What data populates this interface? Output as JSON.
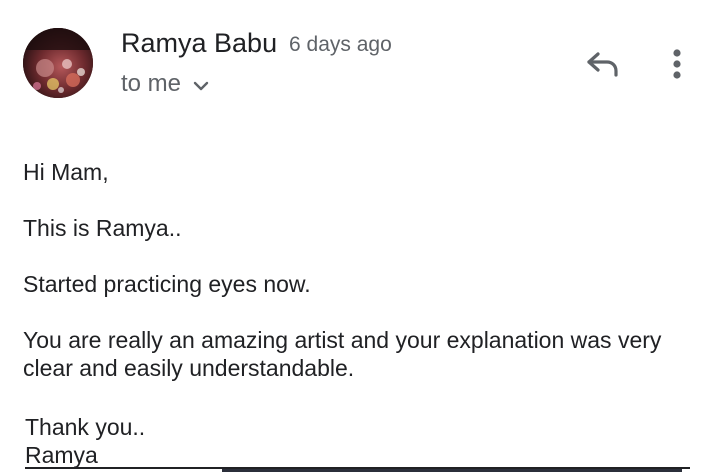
{
  "header": {
    "sender_name": "Ramya Babu",
    "timestamp": "6 days ago",
    "recipient_label": "to me"
  },
  "icons": {
    "avatar": "profile-photo",
    "recipient_toggle": "chevron-down-icon",
    "reply": "reply-icon",
    "more": "more-vert-icon"
  },
  "body": {
    "paragraphs": [
      "Hi Mam,",
      "This is Ramya..",
      "Started practicing eyes now.",
      "You are really an amazing artist and your explanation was very clear and easily understandable."
    ],
    "closing": "Thank you..",
    "signature": "Ramya"
  },
  "colors": {
    "text_primary": "#202124",
    "text_secondary": "#5f6368",
    "icon": "#5f6368",
    "background": "#ffffff"
  }
}
